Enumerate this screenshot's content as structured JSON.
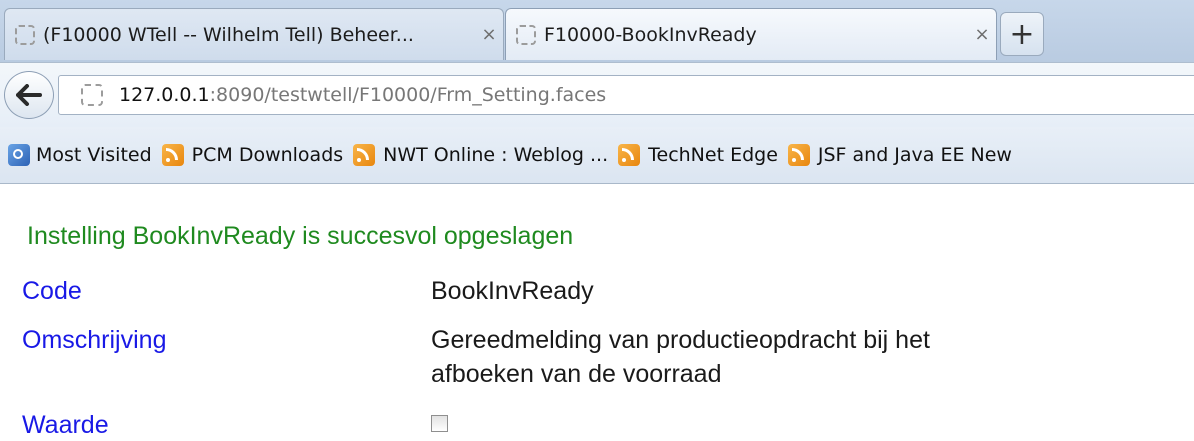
{
  "tabs": [
    {
      "title": "(F10000 WTell -- Wilhelm Tell) Beheer...",
      "close": "×"
    },
    {
      "title": "F10000-BookInvReady",
      "close": "×"
    }
  ],
  "new_tab_label": "+",
  "navigation": {
    "back_label": "🡐",
    "url_host": "127.0.0.1",
    "url_rest": ":8090/testwtell/F10000/Frm_Setting.faces"
  },
  "bookmarks": [
    {
      "label": "Most Visited",
      "icon": "globe-icon"
    },
    {
      "label": "PCM Downloads",
      "icon": "rss-icon"
    },
    {
      "label": "NWT Online : Weblog ...",
      "icon": "rss-icon"
    },
    {
      "label": "TechNet Edge",
      "icon": "rss-icon"
    },
    {
      "label": "JSF and Java EE New",
      "icon": "rss-icon"
    }
  ],
  "page": {
    "message": "Instelling BookInvReady is succesvol opgeslagen",
    "fields": {
      "code_label": "Code",
      "code_value": "BookInvReady",
      "description_label": "Omschrijving",
      "description_value_line1": "Gereedmelding van productieopdracht bij het",
      "description_value_line2": "afboeken van de voorraad",
      "value_label": "Waarde",
      "value_checked": false
    }
  },
  "colors": {
    "message": "#1f8a1f",
    "label": "#1919e6"
  }
}
